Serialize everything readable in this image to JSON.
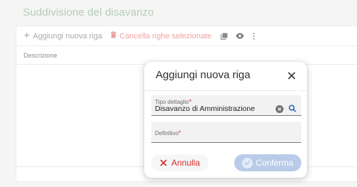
{
  "page": {
    "title": "Suddivisione del disavanzo"
  },
  "toolbar": {
    "add_label": "Aggiungi nuova riga",
    "delete_label": "Cancella righe selezionate"
  },
  "grid": {
    "columns": [
      "Descrizione"
    ]
  },
  "dialog": {
    "title": "Aggiungi nuova riga",
    "fields": [
      {
        "label": "Tipo dettaglio",
        "required_mark": "*",
        "value": "Disavanzo di Amministrazione"
      },
      {
        "label": "Definitivo",
        "required_mark": "*",
        "value": ""
      }
    ],
    "cancel_label": "Annulla",
    "confirm_label": "Conferma"
  },
  "colors": {
    "danger": "#d32f2f",
    "title_green": "#b4cdb8",
    "confirm_disabled": "#b9cbe8"
  },
  "icons": [
    "plus-icon",
    "trash-icon",
    "copy-icon",
    "eye-icon",
    "more-vert-icon",
    "close-icon",
    "clear-icon",
    "search-icon",
    "x-icon",
    "check-circle-icon"
  ]
}
